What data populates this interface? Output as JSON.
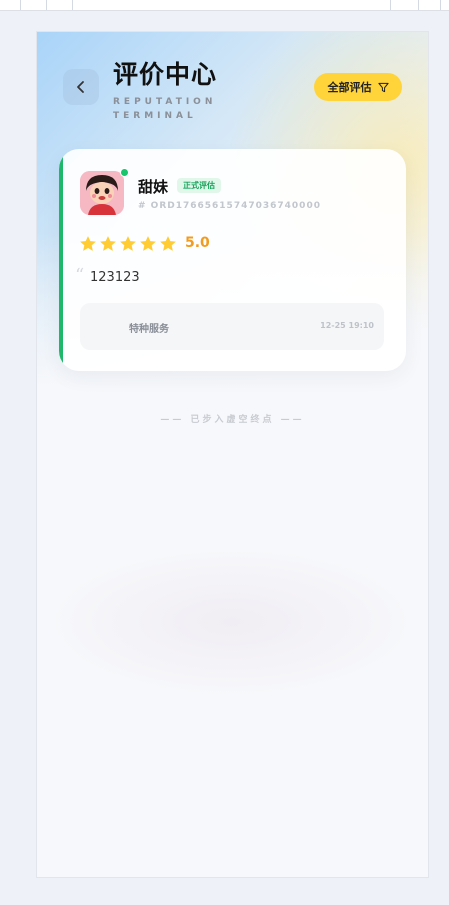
{
  "header": {
    "title": "评价中心",
    "subtitle": "REPUTATION TERMINAL",
    "filter_label": "全部评估"
  },
  "review": {
    "user_name": "甜妹",
    "badge": "正式评估",
    "order_no": "# ORD17665615747036740000",
    "rating": 5,
    "score_text": "5.0",
    "comment": "123123",
    "service": "特种服务",
    "time": "12-25 19:10"
  },
  "footer": {
    "end_text": "—— 已步入虚空终点 ——"
  },
  "colors": {
    "accent_green": "#1fb86b",
    "filter_yellow": "#ffd43b",
    "star": "#ffcc33",
    "score": "#f29c1f"
  }
}
